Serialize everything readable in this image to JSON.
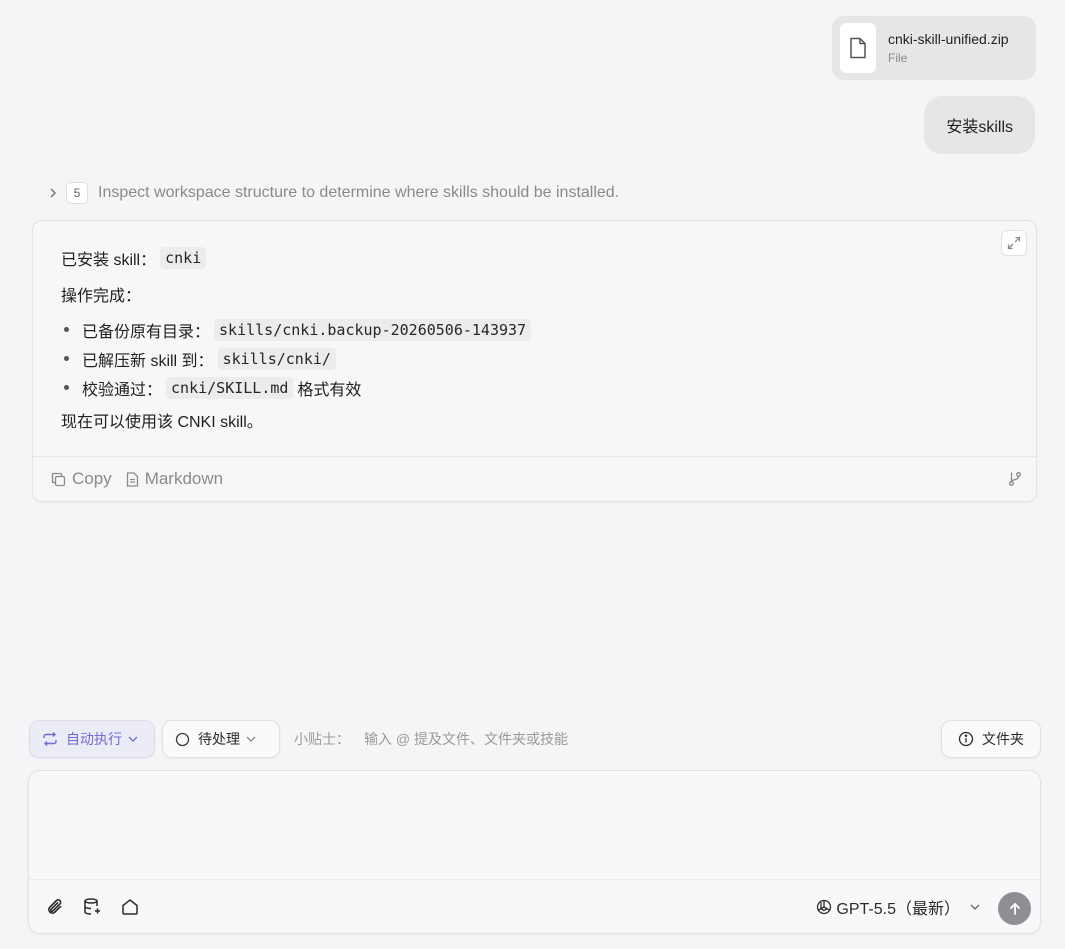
{
  "attachment": {
    "name": "cnki-skill-unified.zip",
    "type": "File",
    "icon": "file-icon"
  },
  "user_message": "安装skills",
  "step": {
    "number": "5",
    "text": "Inspect workspace structure to determine where skills should be installed."
  },
  "response": {
    "installed_label": "已安装 skill：",
    "installed_code": "cnki",
    "done_label": "操作完成：",
    "bullets": [
      {
        "label": "已备份原有目录：",
        "code": "skills/cnki.backup-20260506-143937",
        "suffix": ""
      },
      {
        "label": "已解压新 skill 到：",
        "code": "skills/cnki/",
        "suffix": ""
      },
      {
        "label": "校验通过：",
        "code": "cnki/SKILL.md",
        "suffix": "格式有效"
      }
    ],
    "closing": "现在可以使用该 CNKI skill。",
    "actions": {
      "copy": "Copy",
      "markdown": "Markdown"
    }
  },
  "toolbar": {
    "auto_exec": "自动执行",
    "pending": "待处理",
    "tip_label": "小贴士：",
    "tip_text": "输入 @ 提及文件、文件夹或技能",
    "folder": "文件夹"
  },
  "composer": {
    "placeholder": "",
    "model": "GPT-5.5（最新）"
  },
  "colors": {
    "accent": "#6f6bd8",
    "background": "#f4f5f7",
    "send_button": "#8f8f93"
  }
}
